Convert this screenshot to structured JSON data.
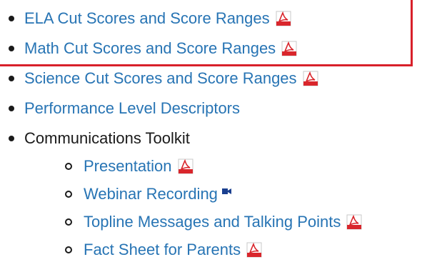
{
  "items": [
    {
      "label": "ELA Cut Scores and Score Ranges",
      "icon": "pdf-icon"
    },
    {
      "label": "Math Cut Scores and Score Ranges",
      "icon": "pdf-icon"
    },
    {
      "label": "Science Cut Scores and Score Ranges",
      "icon": "pdf-icon"
    },
    {
      "label": "Performance Level Descriptors"
    },
    {
      "label": "Communications Toolkit"
    }
  ],
  "toolkit_items": [
    {
      "label": "Presentation",
      "icon": "pdf-icon"
    },
    {
      "label": "Webinar Recording",
      "icon": "video-camera-icon"
    },
    {
      "label": "Topline Messages and Talking Points",
      "icon": "pdf-icon"
    },
    {
      "label": "Fact Sheet for Parents",
      "icon": "pdf-icon"
    }
  ],
  "colors": {
    "link": "#2774b4",
    "text": "#1a1a1a",
    "highlight": "#d8202a",
    "pdf_red": "#d9262c"
  }
}
